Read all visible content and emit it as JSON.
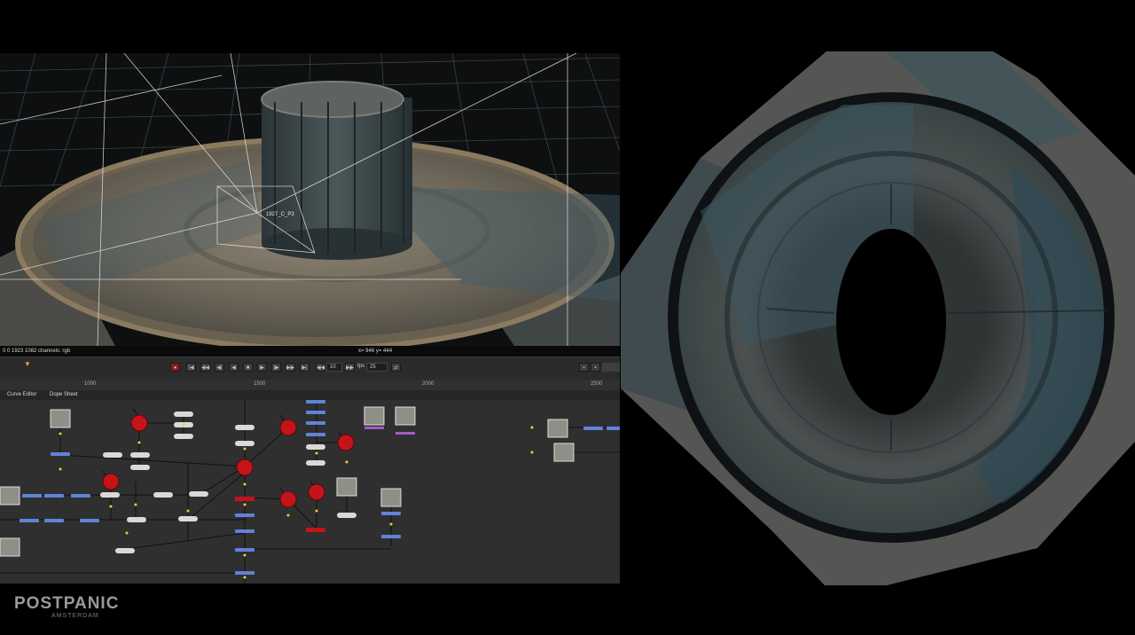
{
  "viewer": {
    "info_left": "0 0 1923 1082 channels: rgb",
    "info_coords": "x= 946 y= 444",
    "corner_label": "1923x1082",
    "camera_label": "1927_C_P3"
  },
  "timeline": {
    "frame_value": "10",
    "fps_label": "fps",
    "fps_value": "25",
    "ruler_ticks": [
      "1000",
      "1500",
      "2000",
      "2500"
    ]
  },
  "tabs": [
    "Curve Editor",
    "Dope Sheet"
  ],
  "watermark": {
    "title": "POSTPANIC",
    "subtitle": "AMSTERDAM"
  },
  "colors": {
    "node_red": "#c4141a",
    "node_blue": "#5f84d6",
    "node_white": "#d9d9d9",
    "node_purple": "#a35cc4",
    "graph_bg": "#2f2f2f"
  }
}
